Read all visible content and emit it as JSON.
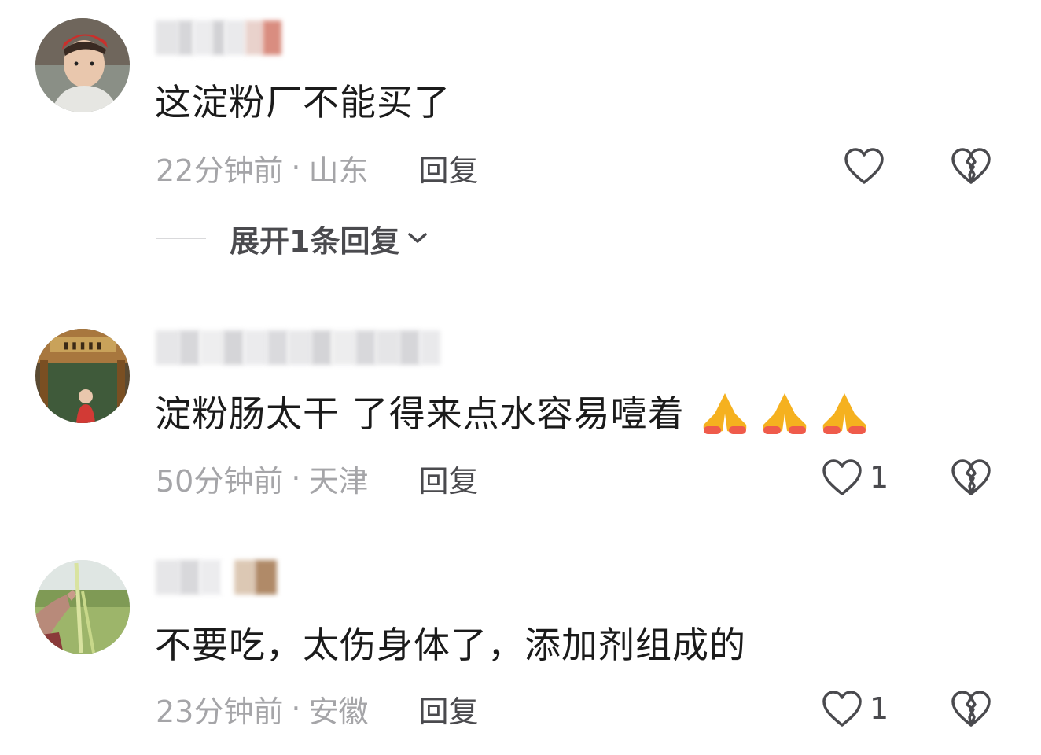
{
  "comments": [
    {
      "text": "这淀粉厂不能买了",
      "time": "22分钟前",
      "location": "山东",
      "reply_label": "回复",
      "likes": "",
      "expand_label": "展开1条回复"
    },
    {
      "text": "淀粉肠太干 了得来点水容易噎着",
      "emoji": "🙏🙏🙏",
      "time": "50分钟前",
      "location": "天津",
      "reply_label": "回复",
      "likes": "1"
    },
    {
      "text": "不要吃，太伤身体了，添加剂组成的",
      "time": "23分钟前",
      "location": "安徽",
      "reply_label": "回复",
      "likes": "1"
    }
  ],
  "separator": "·",
  "colors": {
    "meta_text": "#a5a5a8",
    "action_text": "#4a4a4e",
    "body_text": "#1b1b1b"
  },
  "icons": {
    "like": "heart-outline-icon",
    "dislike": "broken-heart-icon",
    "expand": "chevron-down-icon"
  }
}
